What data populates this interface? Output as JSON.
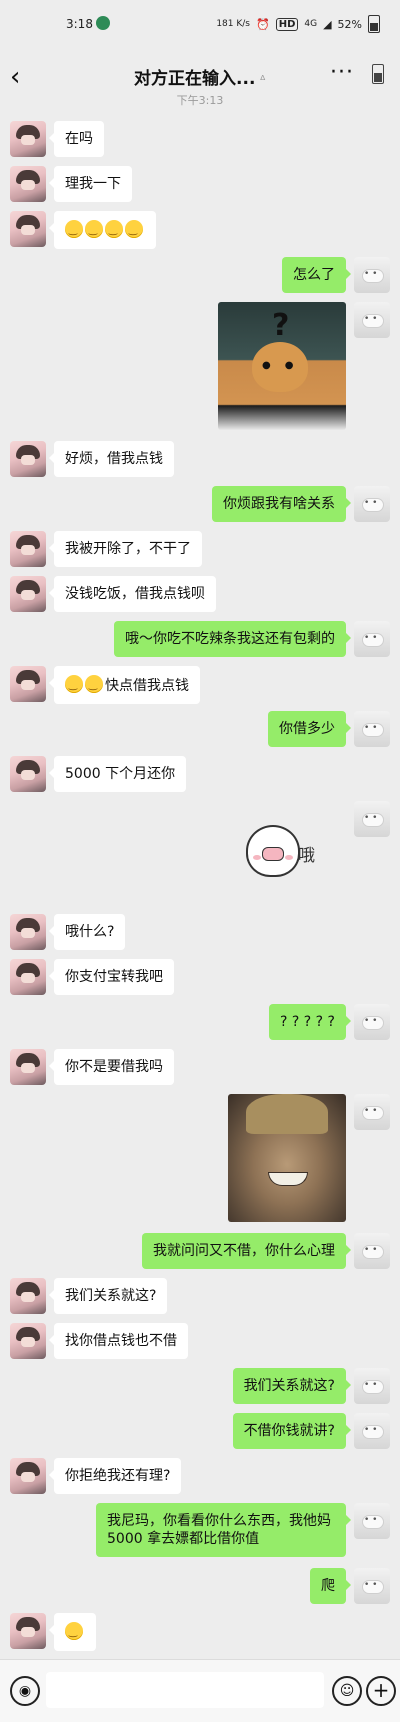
{
  "status_bar": {
    "time": "3:18",
    "network_speed": "181 K/s",
    "hd": "HD",
    "signal": "4G",
    "battery": "52%"
  },
  "header": {
    "title": "对方正在输入...",
    "more": "···"
  },
  "chat": {
    "timestamp": "下午3:13",
    "messages": [
      {
        "side": "left",
        "text": "在吗"
      },
      {
        "side": "left",
        "text": "理我一下"
      },
      {
        "side": "left",
        "emoji_count": 4
      },
      {
        "side": "right",
        "text": "怎么了"
      },
      {
        "side": "right",
        "image": "cat-question-image"
      },
      {
        "side": "left",
        "text": "好烦，借我点钱"
      },
      {
        "side": "right",
        "text": "你烦跟我有啥关系"
      },
      {
        "side": "left",
        "text": "我被开除了，不干了"
      },
      {
        "side": "left",
        "text": "没钱吃饭，借我点钱呗"
      },
      {
        "side": "right",
        "text": "哦～你吃不吃辣条我这还有包剩的"
      },
      {
        "side": "left",
        "text": "快点借我点钱"
      },
      {
        "side": "right",
        "text": "你借多少"
      },
      {
        "side": "left",
        "text": "5000 下个月还你"
      },
      {
        "side": "right",
        "sticker_text": "哦"
      },
      {
        "side": "left",
        "text": "哦什么?"
      },
      {
        "side": "left",
        "text": "你支付宝转我吧"
      },
      {
        "side": "right",
        "text": "? ? ? ? ?"
      },
      {
        "side": "left",
        "text": "你不是要借我吗"
      },
      {
        "side": "right",
        "image": "laughing-man-image"
      },
      {
        "side": "right",
        "text": "我就问问又不借，你什么心理"
      },
      {
        "side": "left",
        "text": "我们关系就这?"
      },
      {
        "side": "left",
        "text": "找你借点钱也不借"
      },
      {
        "side": "right",
        "text": "我们关系就这?"
      },
      {
        "side": "right",
        "text": "不借你钱就讲?"
      },
      {
        "side": "left",
        "text": "你拒绝我还有理?"
      },
      {
        "side": "right",
        "text": "我尼玛，你看看你什么东西，我他妈5000 拿去嫖都比借你值"
      },
      {
        "side": "right",
        "text": "爬"
      },
      {
        "side": "left",
        "emoji_count": 1
      }
    ]
  },
  "input_bar": {
    "voice_icon": "voice-icon",
    "emoji_icon": "emoji-icon",
    "plus_icon": "plus-icon",
    "value": ""
  }
}
